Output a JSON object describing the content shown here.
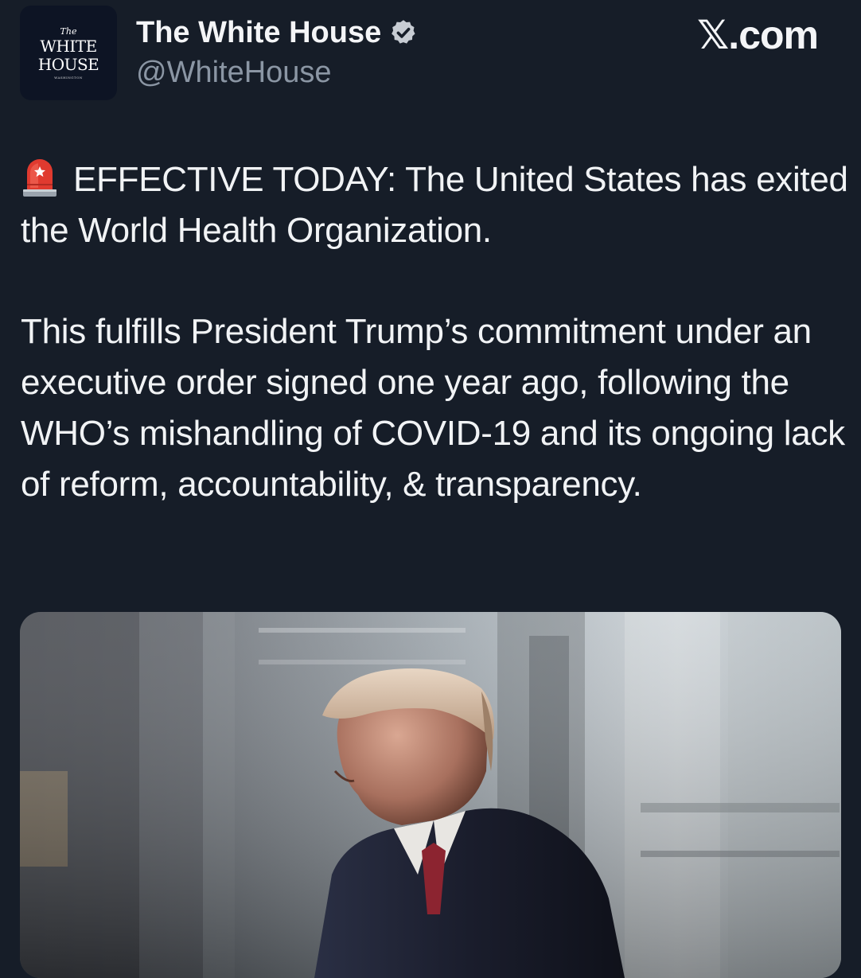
{
  "header": {
    "avatar": {
      "line1": "The",
      "line2": "WHITE",
      "line3": "HOUSE",
      "line4": "WASHINGTON"
    },
    "display_name": "The White House",
    "handle": "@WhiteHouse",
    "verified_icon": "verified-badge-icon",
    "brand": {
      "glyph": "𝕏",
      "suffix": ".com"
    }
  },
  "tweet": {
    "emoji_icon": "police-siren-icon",
    "paragraph1": "EFFECTIVE TODAY: The United States has exited the World Health Organization.",
    "paragraph2": "This fulfills President Trump’s commitment under an executive order signed one year ago, following the WHO’s mishandling of COVID-19 and its ongoing lack of reform, accountability, & transparency."
  },
  "colors": {
    "background": "#161d28",
    "text": "#f1f3f5",
    "handle": "#8b96a4",
    "verified": "#c7ccd3"
  }
}
